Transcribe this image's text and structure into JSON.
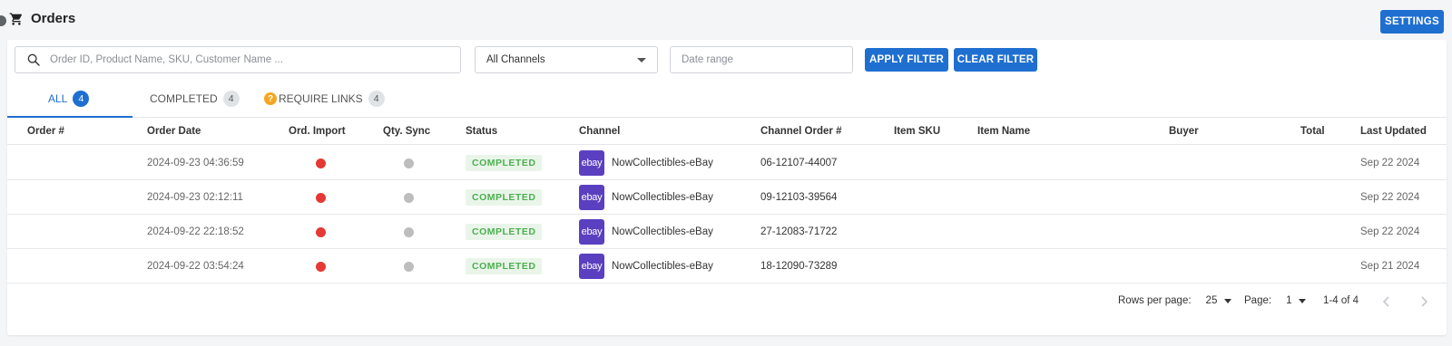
{
  "header": {
    "title": "Orders",
    "settings_label": "SETTINGS"
  },
  "filters": {
    "search_placeholder": "Order ID, Product Name, SKU, Customer Name ...",
    "channel_value": "All Channels",
    "date_placeholder": "Date range",
    "apply_label": "APPLY FILTER",
    "clear_label": "CLEAR FILTER"
  },
  "tabs": [
    {
      "label": "ALL",
      "count": "4",
      "active": true
    },
    {
      "label": "COMPLETED",
      "count": "4"
    },
    {
      "label": "REQUIRE LINKS",
      "count": "4",
      "icon": "question-icon"
    }
  ],
  "table": {
    "columns": [
      "Order #",
      "Order Date",
      "Ord. Import",
      "Qty. Sync",
      "Status",
      "Channel",
      "Channel Order #",
      "Item SKU",
      "Item Name",
      "Buyer",
      "Total",
      "Last Updated"
    ],
    "rows": [
      {
        "order": "",
        "order_date": "2024-09-23 04:36:59",
        "status": "COMPLETED",
        "channel": "NowCollectibles-eBay",
        "channel_order": "06-12107-44007",
        "sku": "",
        "item_name": "",
        "buyer": "",
        "total": "",
        "last_updated": "Sep 22 2024"
      },
      {
        "order": "",
        "order_date": "2024-09-23 02:12:11",
        "status": "COMPLETED",
        "channel": "NowCollectibles-eBay",
        "channel_order": "09-12103-39564",
        "sku": "",
        "item_name": "",
        "buyer": "",
        "total": "",
        "last_updated": "Sep 22 2024"
      },
      {
        "order": "",
        "order_date": "2024-09-22 22:18:52",
        "status": "COMPLETED",
        "channel": "NowCollectibles-eBay",
        "channel_order": "27-12083-71722",
        "sku": "",
        "item_name": "",
        "buyer": "",
        "total": "",
        "last_updated": "Sep 22 2024"
      },
      {
        "order": "",
        "order_date": "2024-09-22 03:54:24",
        "status": "COMPLETED",
        "channel": "NowCollectibles-eBay",
        "channel_order": "18-12090-73289",
        "sku": "",
        "item_name": "",
        "buyer": "",
        "total": "",
        "last_updated": "Sep 21 2024"
      }
    ],
    "channel_logo_text": "ebay"
  },
  "pagination": {
    "rows_per_page_label": "Rows per page:",
    "rows_per_page": "25",
    "page_label": "Page:",
    "page": "1",
    "range": "1-4 of 4"
  },
  "colors": {
    "accent": "#1f6fd1",
    "import_dot": "#e53935",
    "sync_dot": "#bdbdbd",
    "status_green": "#4caf50",
    "ebay_purple": "#5a3fc0"
  }
}
